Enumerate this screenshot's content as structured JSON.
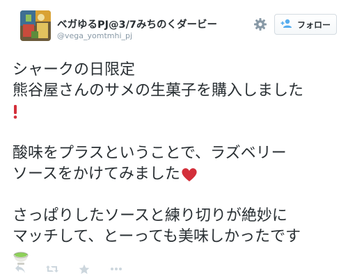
{
  "user": {
    "display_name": "ベガゆるPJ@3/7みちのくダービー",
    "screen_name": "@vega_yomtmhi_pj"
  },
  "follow_button": {
    "label": "フォロー",
    "icon": "add-user-icon"
  },
  "settings_icon": "gear-icon",
  "tweet": {
    "line1": "シャークの日限定",
    "line2": "熊谷屋さんのサメの生菓子を購入しました",
    "line3": "酸味をプラスということで、ラズベリー",
    "line4": "ソースをかけてみました",
    "line5": "さっぱりしたソースと練り切りが絶妙に",
    "line6": "マッチして、とーっても美味しかったです",
    "emojis": [
      "exclamation-emoji",
      "heart-emoji",
      "matcha-emoji"
    ]
  },
  "actions": [
    "reply-icon",
    "retweet-icon",
    "favorite-icon",
    "more-icon"
  ],
  "colors": {
    "text": "#292f33",
    "muted": "#8899a6",
    "icon": "#ccd6dd",
    "follow_icon": "#55acee",
    "heart": "#d32f3a"
  }
}
